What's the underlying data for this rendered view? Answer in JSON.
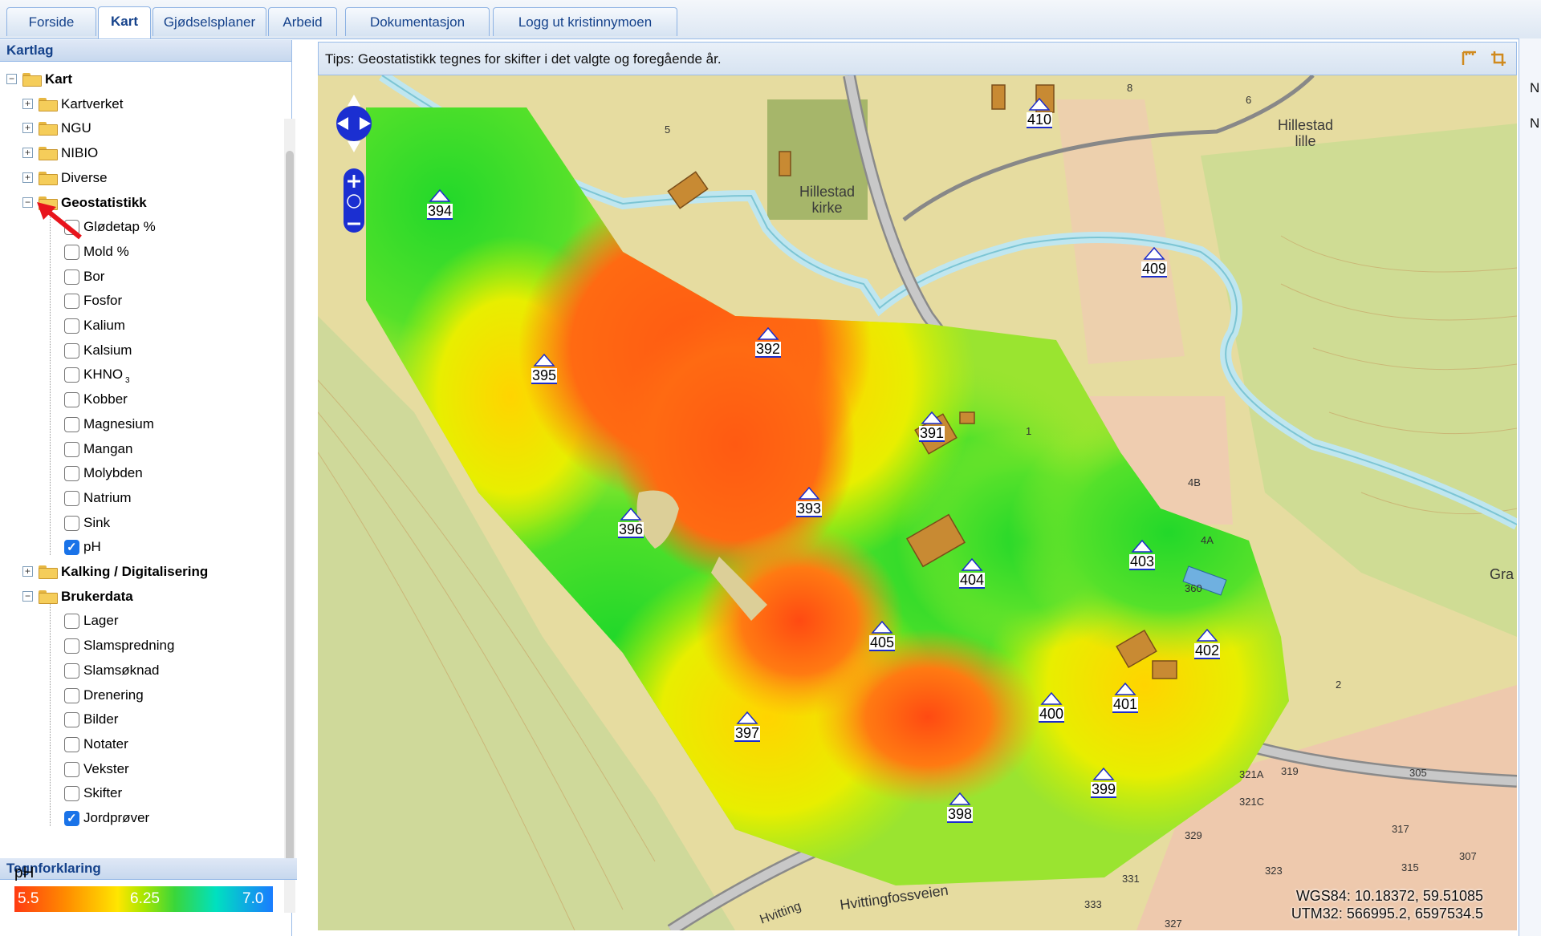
{
  "tabs": [
    {
      "label": "Forside"
    },
    {
      "label": "Kart"
    },
    {
      "label": "Gjødselsplaner"
    },
    {
      "label": "Arbeid"
    },
    {
      "label": "Dokumentasjon"
    },
    {
      "label": "Logg ut kristinnymoen"
    }
  ],
  "sidebar": {
    "title": "Kartlag",
    "root": "Kart",
    "folders": {
      "kartverket": "Kartverket",
      "ngu": "NGU",
      "nibio": "NIBIO",
      "diverse": "Diverse",
      "geostatistikk": "Geostatistikk",
      "kalking": "Kalking / Digitalisering",
      "brukerdata": "Brukerdata"
    },
    "geo_layers": [
      {
        "label": "Glødetap %",
        "checked": false
      },
      {
        "label": "Mold %",
        "checked": false
      },
      {
        "label": "Bor",
        "checked": false
      },
      {
        "label": "Fosfor",
        "checked": false
      },
      {
        "label": "Kalium",
        "checked": false
      },
      {
        "label": "Kalsium",
        "checked": false
      },
      {
        "label": "KHNO",
        "sub": "3",
        "checked": false
      },
      {
        "label": "Kobber",
        "checked": false
      },
      {
        "label": "Magnesium",
        "checked": false
      },
      {
        "label": "Mangan",
        "checked": false
      },
      {
        "label": "Molybden",
        "checked": false
      },
      {
        "label": "Natrium",
        "checked": false
      },
      {
        "label": "Sink",
        "checked": false
      },
      {
        "label": "pH",
        "checked": true
      }
    ],
    "user_layers": [
      {
        "label": "Lager",
        "checked": false
      },
      {
        "label": "Slamspredning",
        "checked": false
      },
      {
        "label": "Slamsøknad",
        "checked": false
      },
      {
        "label": "Drenering",
        "checked": false
      },
      {
        "label": "Bilder",
        "checked": false
      },
      {
        "label": "Notater",
        "checked": false
      },
      {
        "label": "Vekster",
        "checked": false
      },
      {
        "label": "Skifter",
        "checked": false
      },
      {
        "label": "Jordprøver",
        "checked": true
      }
    ]
  },
  "legend": {
    "title": "Tegnforklaring",
    "layer": "pH",
    "min": "5.5",
    "mid": "6.25",
    "max": "7.0"
  },
  "tip": "Tips: Geostatistikk tegnes for skifter i det valgte og foregående år.",
  "map": {
    "place_labels": {
      "church_line1": "Hillestad",
      "church_line2": "kirke",
      "farm_line1": "Hillestad",
      "farm_line2": "lille",
      "road": "Hvittingfossveien",
      "road_short": "Hvitting",
      "edge": "Gra"
    },
    "sample_points": [
      "394",
      "395",
      "392",
      "391",
      "393",
      "396",
      "404",
      "403",
      "405",
      "402",
      "400",
      "401",
      "397",
      "399",
      "398",
      "410",
      "409"
    ],
    "building_numbers": [
      "8",
      "6",
      "5",
      "1",
      "4B",
      "4A",
      "360",
      "2",
      "319",
      "321A",
      "321C",
      "305",
      "317",
      "307",
      "315",
      "329",
      "323",
      "331",
      "333",
      "327"
    ],
    "coords_wgs": "WGS84: 10.18372, 59.51085",
    "coords_utm": "UTM32: 566995.2, 6597534.5"
  },
  "right_strip": {
    "a": "N",
    "b": "N"
  },
  "colors": {
    "header_blue": "#15428b",
    "border_blue": "#99bbe8",
    "checkbox_blue": "#1a73e8"
  }
}
